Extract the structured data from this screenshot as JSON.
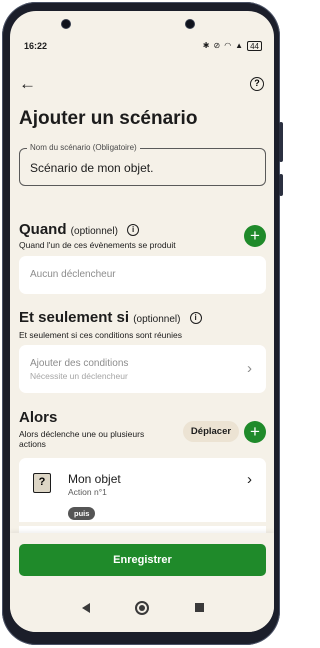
{
  "status": {
    "time": "16:22",
    "icons": [
      "bluetooth-icon",
      "mute-icon",
      "wifi-icon",
      "network-icon"
    ],
    "battery": "44"
  },
  "header": {
    "title": "Ajouter un scénario"
  },
  "name_field": {
    "label": "Nom du scénario (Obligatoire)",
    "value": "Scénario de mon objet."
  },
  "quand": {
    "title": "Quand",
    "optional": "(optionnel)",
    "subtitle": "Quand l'un de ces évènements se produit",
    "placeholder": "Aucun déclencheur"
  },
  "seulement": {
    "title": "Et seulement si",
    "optional": "(optionnel)",
    "subtitle": "Et seulement si ces conditions sont réunies",
    "placeholder": "Ajouter des conditions",
    "hint": "Nécessite un déclencheur"
  },
  "alors": {
    "title": "Alors",
    "subtitle_line1": "Alors déclenche une ou plusieurs",
    "subtitle_line2": "actions",
    "move_label": "Déplacer",
    "action": {
      "title": "Mon objet",
      "subtitle": "Action n°1",
      "icon_glyph": "?"
    },
    "puis_label": "puis"
  },
  "footer": {
    "save_label": "Enregistrer"
  },
  "colors": {
    "accent": "#1f8a2a",
    "background": "#f5f1e8",
    "card": "#ffffff"
  }
}
